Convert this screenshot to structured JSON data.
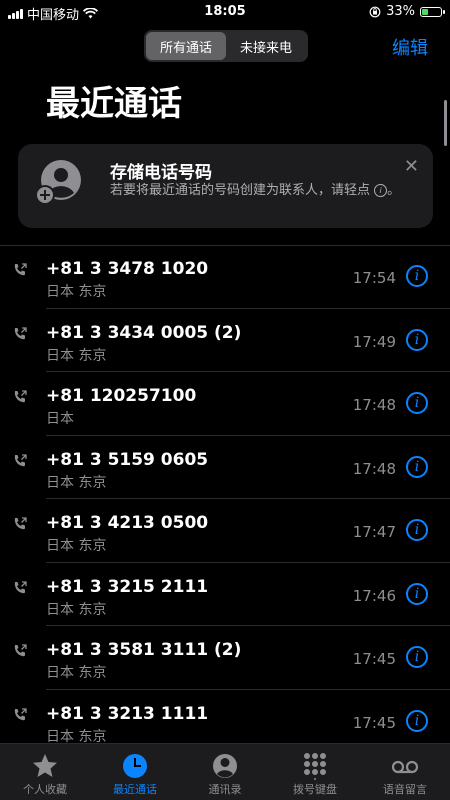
{
  "status_bar": {
    "carrier": "中国移动",
    "time": "18:05",
    "battery": "33%",
    "battery_level": 0.33
  },
  "header": {
    "segments": [
      "所有通话",
      "未接来电"
    ],
    "selected_segment": "所有通话",
    "edit_label": "编辑",
    "title": "最近通话"
  },
  "banner": {
    "title": "存储电话号码",
    "body": "若要将最近通话的号码创建为联系人，请轻点",
    "close_icon": "close-icon"
  },
  "calls": [
    {
      "number": "+81 3 3478 1020",
      "location": "日本 东京",
      "time": "17:54"
    },
    {
      "number": "+81 3 3434 0005 (2)",
      "location": "日本 东京",
      "time": "17:49"
    },
    {
      "number": "+81 120257100",
      "location": "日本",
      "time": "17:48"
    },
    {
      "number": "+81 3 5159 0605",
      "location": "日本 东京",
      "time": "17:48"
    },
    {
      "number": "+81 3 4213 0500",
      "location": "日本 东京",
      "time": "17:47"
    },
    {
      "number": "+81 3 3215 2111",
      "location": "日本 东京",
      "time": "17:46"
    },
    {
      "number": "+81 3 3581 3111 (2)",
      "location": "日本 东京",
      "time": "17:45"
    },
    {
      "number": "+81 3 3213 1111",
      "location": "日本 东京",
      "time": "17:45"
    }
  ],
  "tab_bar": {
    "tabs": [
      {
        "label": "个人收藏",
        "icon": "star-icon"
      },
      {
        "label": "最近通话",
        "icon": "clock-icon"
      },
      {
        "label": "通讯录",
        "icon": "contacts-icon"
      },
      {
        "label": "拨号键盘",
        "icon": "keypad-icon"
      },
      {
        "label": "语音留言",
        "icon": "voicemail-icon"
      }
    ],
    "active": "最近通话"
  },
  "colors": {
    "accent": "#0a84ff",
    "background": "#000000",
    "secondary_text": "#8e8e93"
  }
}
